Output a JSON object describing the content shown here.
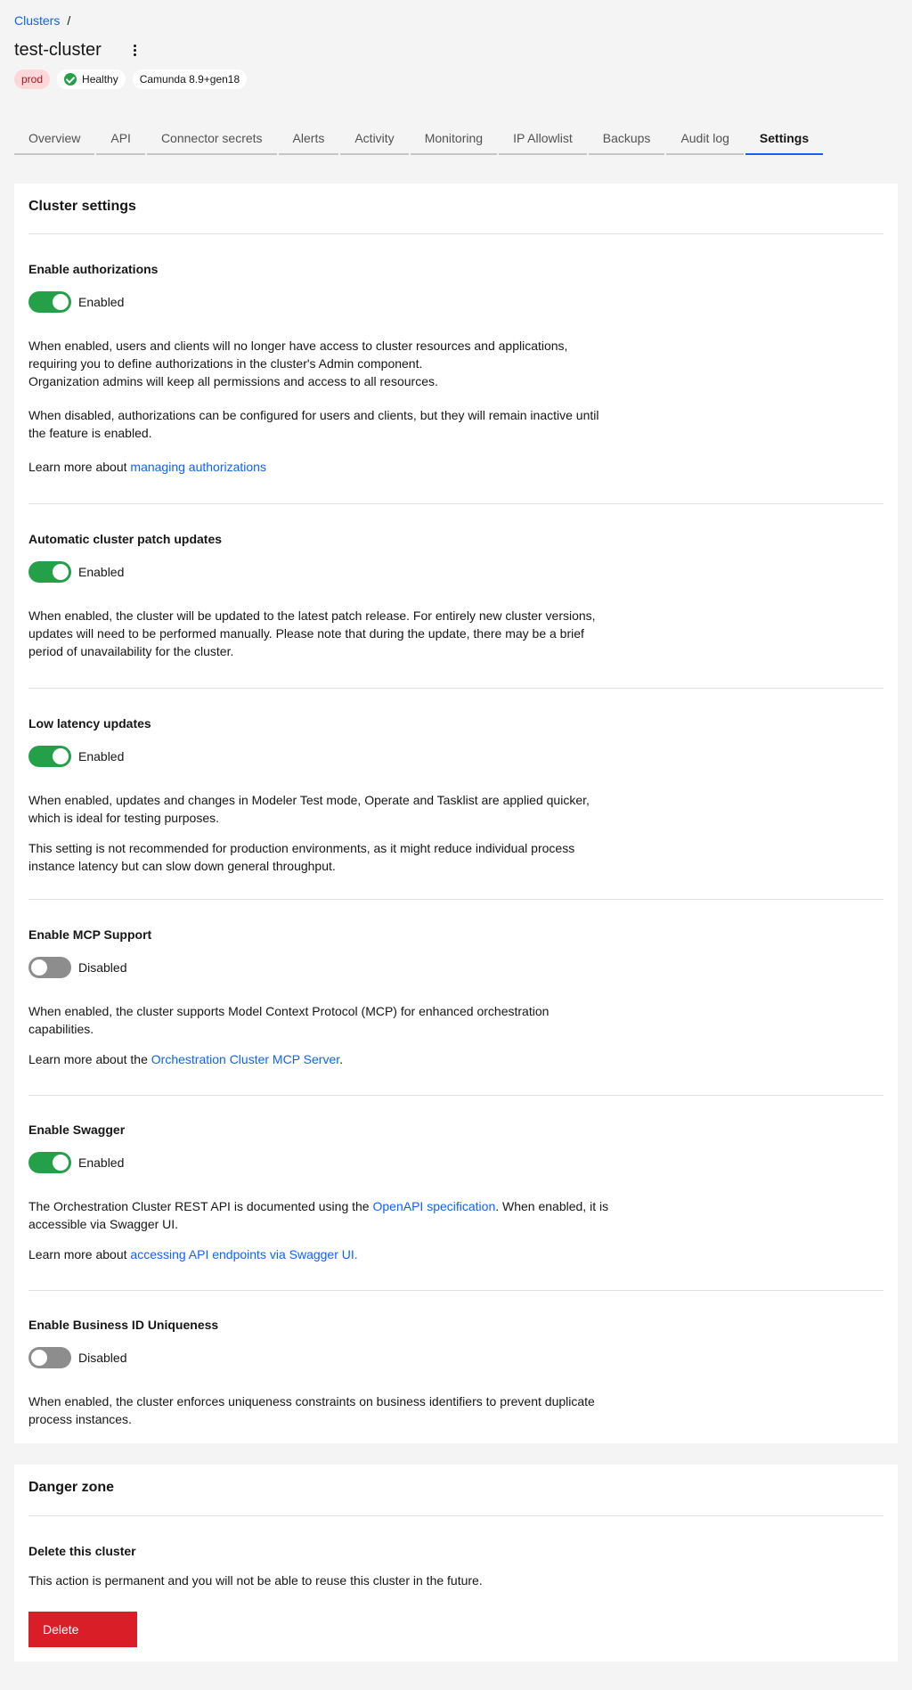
{
  "breadcrumb": {
    "link": "Clusters",
    "separator": "/"
  },
  "page": {
    "title": "test-cluster",
    "menu_icon": "overflow-menu-icon"
  },
  "tags": {
    "env": "prod",
    "health": "Healthy",
    "version": "Camunda 8.9+gen18"
  },
  "tabs": [
    {
      "label": "Overview"
    },
    {
      "label": "API"
    },
    {
      "label": "Connector secrets"
    },
    {
      "label": "Alerts"
    },
    {
      "label": "Activity"
    },
    {
      "label": "Monitoring"
    },
    {
      "label": "IP Allowlist"
    },
    {
      "label": "Backups"
    },
    {
      "label": "Audit log"
    },
    {
      "label": "Settings",
      "active": true
    }
  ],
  "settings": {
    "title": "Cluster settings",
    "authorizations": {
      "title": "Enable authorizations",
      "state": "Enabled",
      "p1_line1": "When enabled, users and clients will no longer have access to cluster resources and applications,",
      "p1_line2": "requiring you to define authorizations in the cluster's Admin component.",
      "p1_line3": "Organization admins will keep all permissions and access to all resources.",
      "p2": "When disabled, authorizations can be configured for users and clients, but they will remain inactive until the feature is enabled.",
      "learn_prefix": "Learn more about ",
      "learn_link": "managing authorizations"
    },
    "patch": {
      "title": "Automatic cluster patch updates",
      "state": "Enabled",
      "p1": "When enabled, the cluster will be updated to the latest patch release. For entirely new cluster versions, updates will need to be performed manually. Please note that during the update, there may be a brief period of unavailability for the cluster."
    },
    "latency": {
      "title": "Low latency updates",
      "state": "Enabled",
      "p1": "When enabled, updates and changes in Modeler Test mode, Operate and Tasklist are applied quicker, which is ideal for testing purposes.",
      "p2": "This setting is not recommended for production environments, as it might reduce individual process instance latency but can slow down general throughput."
    },
    "mcp": {
      "title": "Enable MCP Support",
      "state": "Disabled",
      "p1": "When enabled, the cluster supports Model Context Protocol (MCP) for enhanced orchestration capabilities.",
      "learn_prefix": "Learn more about the ",
      "learn_link": "Orchestration Cluster MCP Server",
      "learn_suffix": "."
    },
    "swagger": {
      "title": "Enable Swagger",
      "state": "Enabled",
      "p1_prefix": "The Orchestration Cluster REST API is documented using the ",
      "p1_link": "OpenAPI specification",
      "p1_suffix": ". When enabled, it is accessible via Swagger UI.",
      "learn_prefix": "Learn more about ",
      "learn_link": "accessing API endpoints via Swagger UI."
    },
    "business_id": {
      "title": "Enable Business ID Uniqueness",
      "state": "Disabled",
      "p1": "When enabled, the cluster enforces uniqueness constraints on business identifiers to prevent duplicate process instances."
    }
  },
  "danger": {
    "title": "Danger zone",
    "delete_title": "Delete this cluster",
    "delete_desc": "This action is permanent and you will not be able to reuse this cluster in the future.",
    "delete_button": "Delete"
  },
  "colors": {
    "accent": "#0f62fe",
    "toggle_on": "#24a148",
    "toggle_off": "#8d8d8d",
    "danger": "#da1e28",
    "prod_tag_bg": "#ffd7d9"
  }
}
